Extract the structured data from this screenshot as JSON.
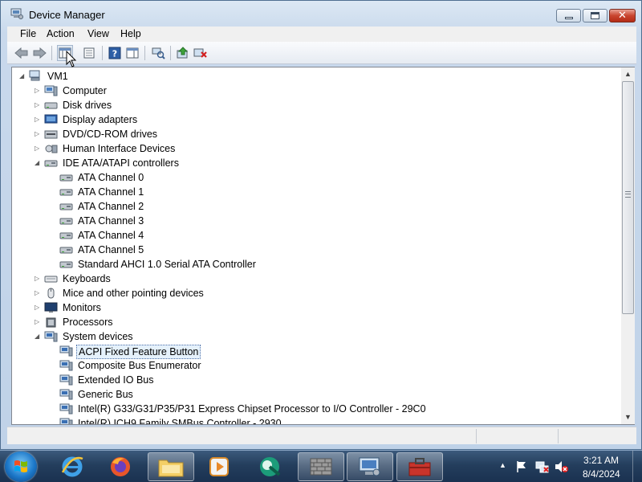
{
  "window": {
    "title": "Device Manager"
  },
  "menu": [
    "File",
    "Action",
    "View",
    "Help"
  ],
  "tree": {
    "root": "VM1",
    "categories": [
      "Computer",
      "Disk drives",
      "Display adapters",
      "DVD/CD-ROM drives",
      "Human Interface Devices",
      "IDE ATA/ATAPI controllers"
    ],
    "ide_children": [
      "ATA Channel 0",
      "ATA Channel 1",
      "ATA Channel 2",
      "ATA Channel 3",
      "ATA Channel 4",
      "ATA Channel 5",
      "Standard AHCI 1.0 Serial ATA Controller"
    ],
    "categories2": [
      "Keyboards",
      "Mice and other pointing devices",
      "Monitors",
      "Processors",
      "System devices"
    ],
    "system_children": [
      "ACPI Fixed Feature Button",
      "Composite Bus Enumerator",
      "Extended IO Bus",
      "Generic Bus",
      "Intel(R) G33/G31/P35/P31 Express Chipset Processor to I/O Controller - 29C0",
      "Intel(R) ICH9 Family SMBus Controller - 2930"
    ],
    "selected": "ACPI Fixed Feature Button"
  },
  "taskbar": {
    "time": "3:21 AM",
    "date": "8/4/2024"
  }
}
